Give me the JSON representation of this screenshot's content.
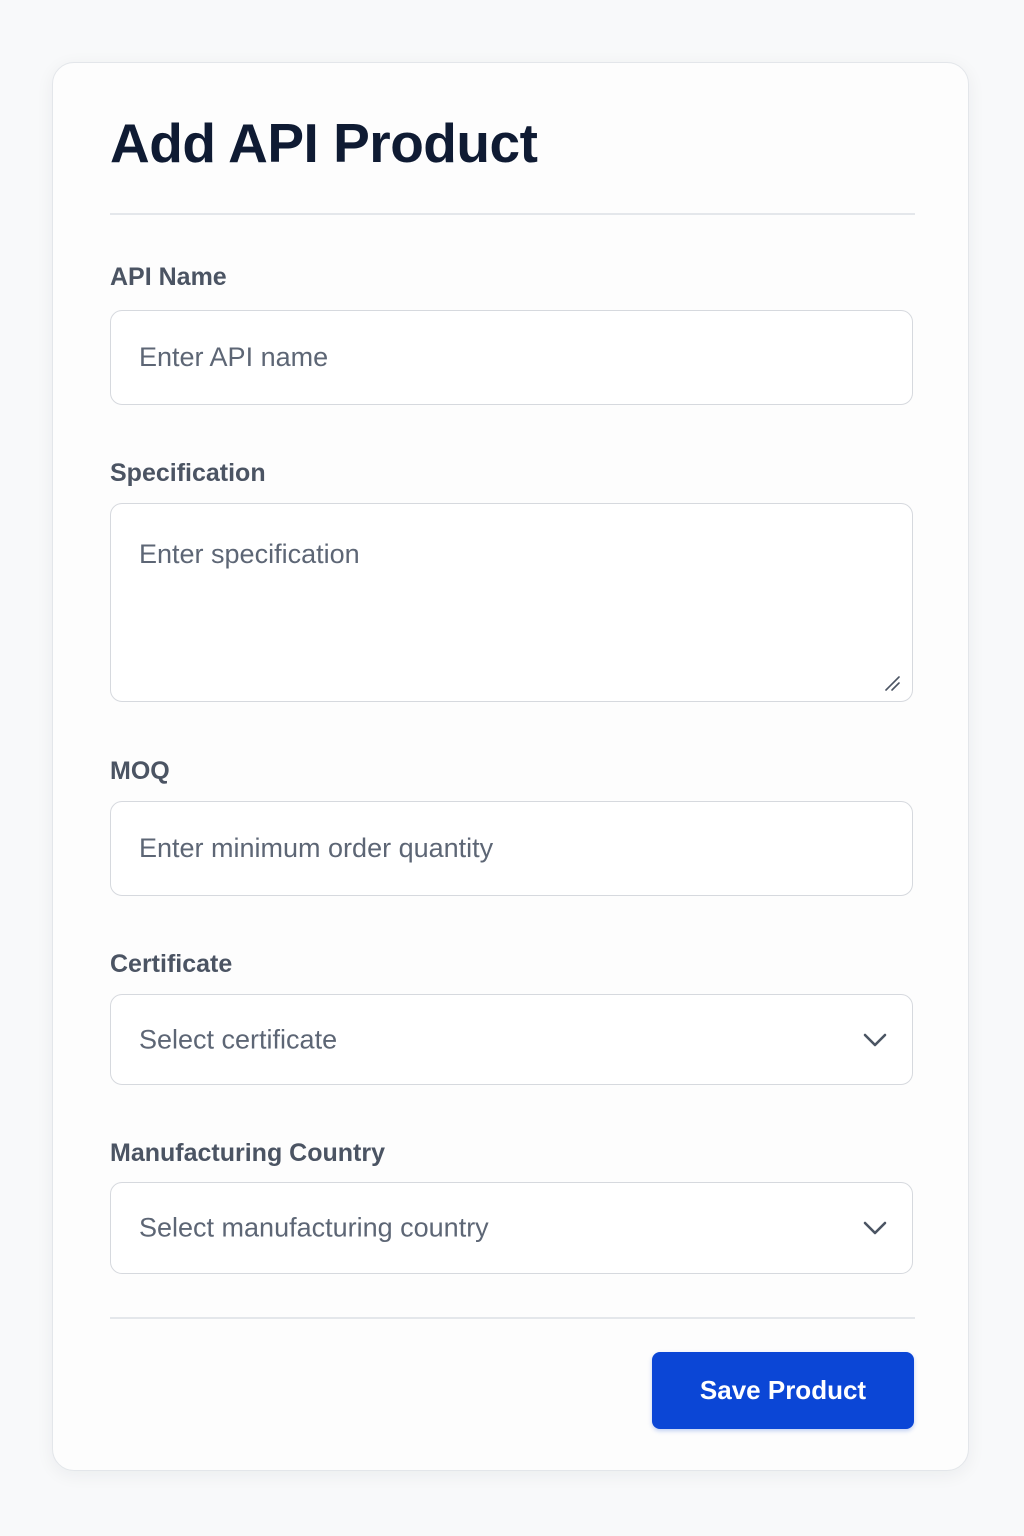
{
  "form": {
    "title": "Add API Product",
    "fields": {
      "api_name": {
        "label": "API Name",
        "placeholder": "Enter API name",
        "value": ""
      },
      "specification": {
        "label": "Specification",
        "placeholder": "Enter specification",
        "value": ""
      },
      "moq": {
        "label": "MOQ",
        "placeholder": "Enter minimum order quantity",
        "value": ""
      },
      "certificate": {
        "label": "Certificate",
        "selected": "Select certificate",
        "icon": "chevron-down-icon"
      },
      "manufacturing_country": {
        "label": "Manufacturing Country",
        "selected": "Select manufacturing country",
        "icon": "chevron-down-icon"
      }
    },
    "save_label": "Save Product",
    "colors": {
      "accent": "#0b46d6",
      "title": "#0f1b33",
      "label": "#4b5463",
      "placeholder": "#5d6675"
    }
  }
}
